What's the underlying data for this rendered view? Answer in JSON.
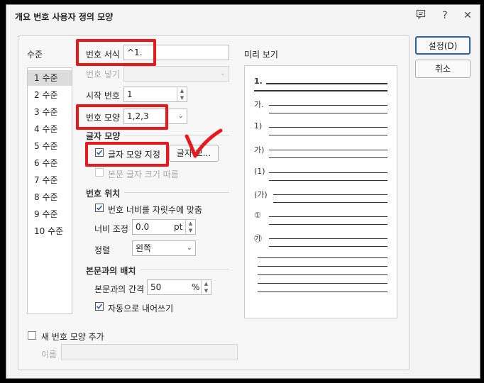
{
  "window": {
    "title": "개요 번호 사용자 정의 모양",
    "icons": [
      "chat-icon",
      "help-icon",
      "close-icon"
    ],
    "help_glyph": "?",
    "close_glyph": "✕"
  },
  "levels": {
    "label": "수준",
    "items": [
      "1 수준",
      "2 수준",
      "3 수준",
      "4 수준",
      "5 수준",
      "6 수준",
      "7 수준",
      "8 수준",
      "9 수준",
      "10 수준"
    ],
    "selected_index": 0
  },
  "number_format": {
    "label": "번호 서식",
    "value": "^1."
  },
  "number_insert": {
    "label": "번호 넣기",
    "value": ""
  },
  "start_number": {
    "label": "시작 번호",
    "value": "1"
  },
  "number_shape": {
    "label": "번호 모양",
    "value": "1,2,3"
  },
  "char_shape": {
    "section_label": "글자 모양",
    "specify_label": "글자 모양 지정",
    "specify_checked": true,
    "button_label": "글자 모...",
    "follow_body_label": "본문 글자 크기 따름",
    "follow_body_checked": false
  },
  "number_position": {
    "section_label": "번호 위치",
    "fit_width_label": "번호 너비를 자릿수에 맞춤",
    "fit_width_checked": true,
    "width_adjust_label": "너비 조정",
    "width_adjust_value": "0.0",
    "width_adjust_unit": "pt",
    "align_label": "정렬",
    "align_value": "왼쪽"
  },
  "body_layout": {
    "section_label": "본문과의 배치",
    "gap_label": "본문과의 간격",
    "gap_value": "50",
    "gap_unit": "%",
    "auto_indent_label": "자동으로 내어쓰기",
    "auto_indent_checked": true
  },
  "add_shape": {
    "label": "새 번호 모양 추가",
    "checked": false,
    "name_label": "이름",
    "name_value": ""
  },
  "preview": {
    "label": "미리 보기",
    "numbers": [
      "1.",
      "가.",
      "1)",
      "가)",
      "(1)",
      "(가)",
      "①",
      "㉮"
    ]
  },
  "buttons": {
    "ok": "설정(D)",
    "cancel": "취소"
  },
  "annotation": {
    "color": "#e8191c",
    "check_glyph": "✔"
  }
}
